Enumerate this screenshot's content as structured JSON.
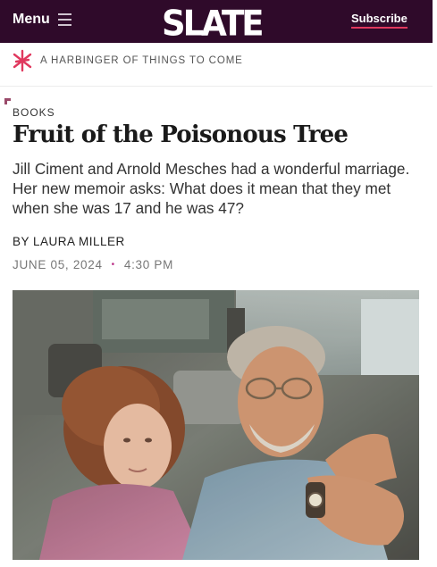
{
  "header": {
    "menu_label": "Menu",
    "logo_text": "SLATE",
    "subscribe_label": "Subscribe"
  },
  "series": {
    "label": "A HARBINGER OF THINGS TO COME",
    "icon": "harbinger-star-icon"
  },
  "article": {
    "kicker": "BOOKS",
    "headline": "Fruit of the Poisonous Tree",
    "dek": "Jill Ciment and Arnold Mesches had a wonderful marriage. Her new memoir asks: What does it mean that they met when she was 17 and he was 47?",
    "byline": "BY LAURA MILLER",
    "date": "JUNE 05, 2024",
    "time": "4:30 PM"
  },
  "colors": {
    "header_bg": "#2f0a2a",
    "accent": "#e0385e",
    "series_icon": "#e0385e"
  }
}
